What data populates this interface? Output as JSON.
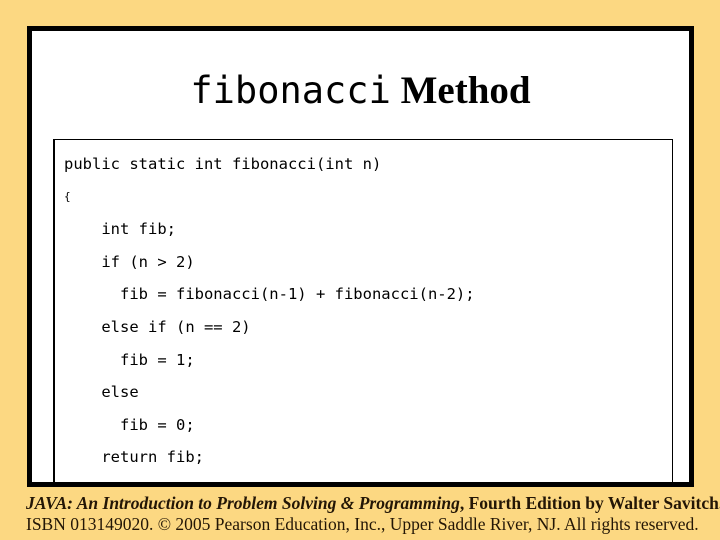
{
  "slide": {
    "background_color": "#fcd882",
    "panel_background": "#ffffff",
    "border_color": "#000000"
  },
  "title": {
    "mono_part": "fibonacci",
    "serif_part": " Method"
  },
  "code": {
    "lines": [
      {
        "text": "public static int fibonacci(int n)",
        "indent": 0,
        "small": false
      },
      {
        "text": "{",
        "indent": 0,
        "small": true
      },
      {
        "text": "int fib;",
        "indent": 4,
        "small": false
      },
      {
        "text": "if (n > 2)",
        "indent": 4,
        "small": false
      },
      {
        "text": "fib = fibonacci(n-1) + fibonacci(n-2);",
        "indent": 6,
        "small": false
      },
      {
        "text": "else if (n == 2)",
        "indent": 4,
        "small": false
      },
      {
        "text": "fib = 1;",
        "indent": 6,
        "small": false
      },
      {
        "text": "else",
        "indent": 4,
        "small": false
      },
      {
        "text": "fib = 0;",
        "indent": 6,
        "small": false
      },
      {
        "text": "return fib;",
        "indent": 4,
        "small": false
      },
      {
        "text": "}",
        "indent": 0,
        "small": true
      }
    ]
  },
  "footer": {
    "line1_book": "JAVA: An Introduction to Problem Solving & Programming",
    "line1_rest": ", Fourth Edition by Walter Savitch.",
    "line2": "ISBN 013149020. © 2005 Pearson Education, Inc., Upper Saddle River, NJ. All rights reserved."
  }
}
